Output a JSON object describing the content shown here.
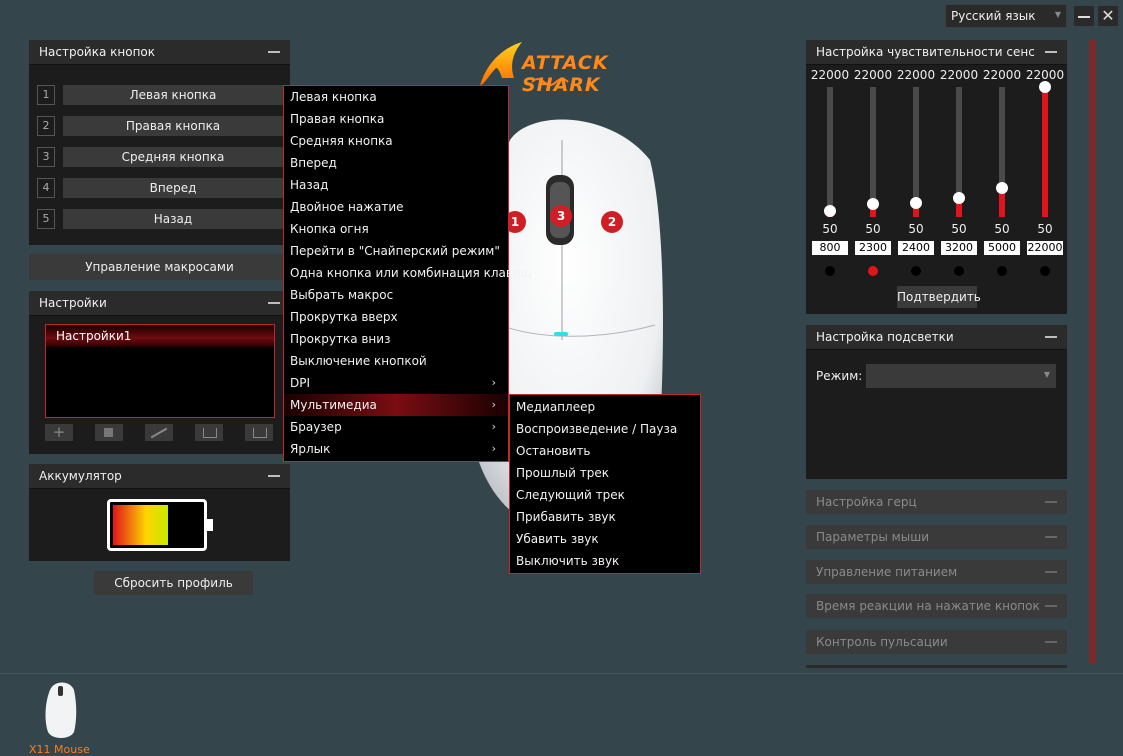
{
  "header": {
    "language": "Русский язык",
    "brand": "ATTACK SHARK"
  },
  "buttons_panel": {
    "title": "Настройка кнопок",
    "rows": [
      {
        "num": "1",
        "label": "Левая кнопка"
      },
      {
        "num": "2",
        "label": "Правая кнопка"
      },
      {
        "num": "3",
        "label": "Средняя кнопка"
      },
      {
        "num": "4",
        "label": "Вперед"
      },
      {
        "num": "5",
        "label": "Назад"
      }
    ]
  },
  "macro_button": "Управление макросами",
  "settings_panel": {
    "title": "Настройки",
    "profiles": [
      "Настройки1"
    ],
    "toolbar_icons": [
      "plus-icon",
      "trash-icon",
      "pencil-icon",
      "import-icon",
      "export-icon"
    ]
  },
  "battery_panel": {
    "title": "Аккумулятор",
    "level_fraction": 0.63
  },
  "reset_button": "Сбросить профиль",
  "context_menu": {
    "items": [
      {
        "label": "Левая кнопка",
        "submenu": false
      },
      {
        "label": "Правая кнопка",
        "submenu": false
      },
      {
        "label": "Средняя кнопка",
        "submenu": false
      },
      {
        "label": "Вперед",
        "submenu": false
      },
      {
        "label": "Назад",
        "submenu": false
      },
      {
        "label": "Двойное нажатие",
        "submenu": false
      },
      {
        "label": "Кнопка огня",
        "submenu": false
      },
      {
        "label": "Перейти в \"Снайперский режим\"",
        "submenu": false
      },
      {
        "label": "Одна кнопка или комбинация клавиш",
        "submenu": false
      },
      {
        "label": "Выбрать макрос",
        "submenu": false
      },
      {
        "label": "Прокрутка вверх",
        "submenu": false
      },
      {
        "label": "Прокрутка вниз",
        "submenu": false
      },
      {
        "label": "Выключение кнопкой",
        "submenu": false
      },
      {
        "label": "DPI",
        "submenu": true
      },
      {
        "label": "Мультимедиа",
        "submenu": true,
        "highlighted": true
      },
      {
        "label": "Браузер",
        "submenu": true
      },
      {
        "label": "Ярлык",
        "submenu": true
      }
    ]
  },
  "multimedia_submenu": {
    "items": [
      "Медиаплеер",
      "Воспроизведение / Пауза",
      "Остановить",
      "Прошлый трек",
      "Следующий трек",
      "Прибавить звук",
      "Убавить звук",
      "Выключить звук"
    ]
  },
  "mouse_markers": [
    "1",
    "3",
    "2"
  ],
  "sensitivity_panel": {
    "title": "Настройка чувствительности сенс",
    "max_label": "22000",
    "min_label": "50",
    "levels": [
      {
        "value": "800",
        "fraction": 0.034,
        "active": false
      },
      {
        "value": "2300",
        "fraction": 0.103,
        "active": true
      },
      {
        "value": "2400",
        "fraction": 0.107,
        "active": false
      },
      {
        "value": "3200",
        "fraction": 0.144,
        "active": false
      },
      {
        "value": "5000",
        "fraction": 0.226,
        "active": false
      },
      {
        "value": "22000",
        "fraction": 1.0,
        "active": false
      }
    ],
    "confirm": "Подтвердить"
  },
  "lighting_panel": {
    "title": "Настройка подсветки",
    "mode_label": "Режим:",
    "mode_value": ""
  },
  "collapsed_panels": [
    "Настройка герц",
    "Параметры мыши",
    "Управление питанием",
    "Время реакции на нажатие кнопок",
    "Контроль пульсации"
  ],
  "device": {
    "name": "X11 Mouse"
  },
  "colors": {
    "accent": "#e0141c",
    "background": "#34464b",
    "device_label": "#ff7a1a"
  }
}
